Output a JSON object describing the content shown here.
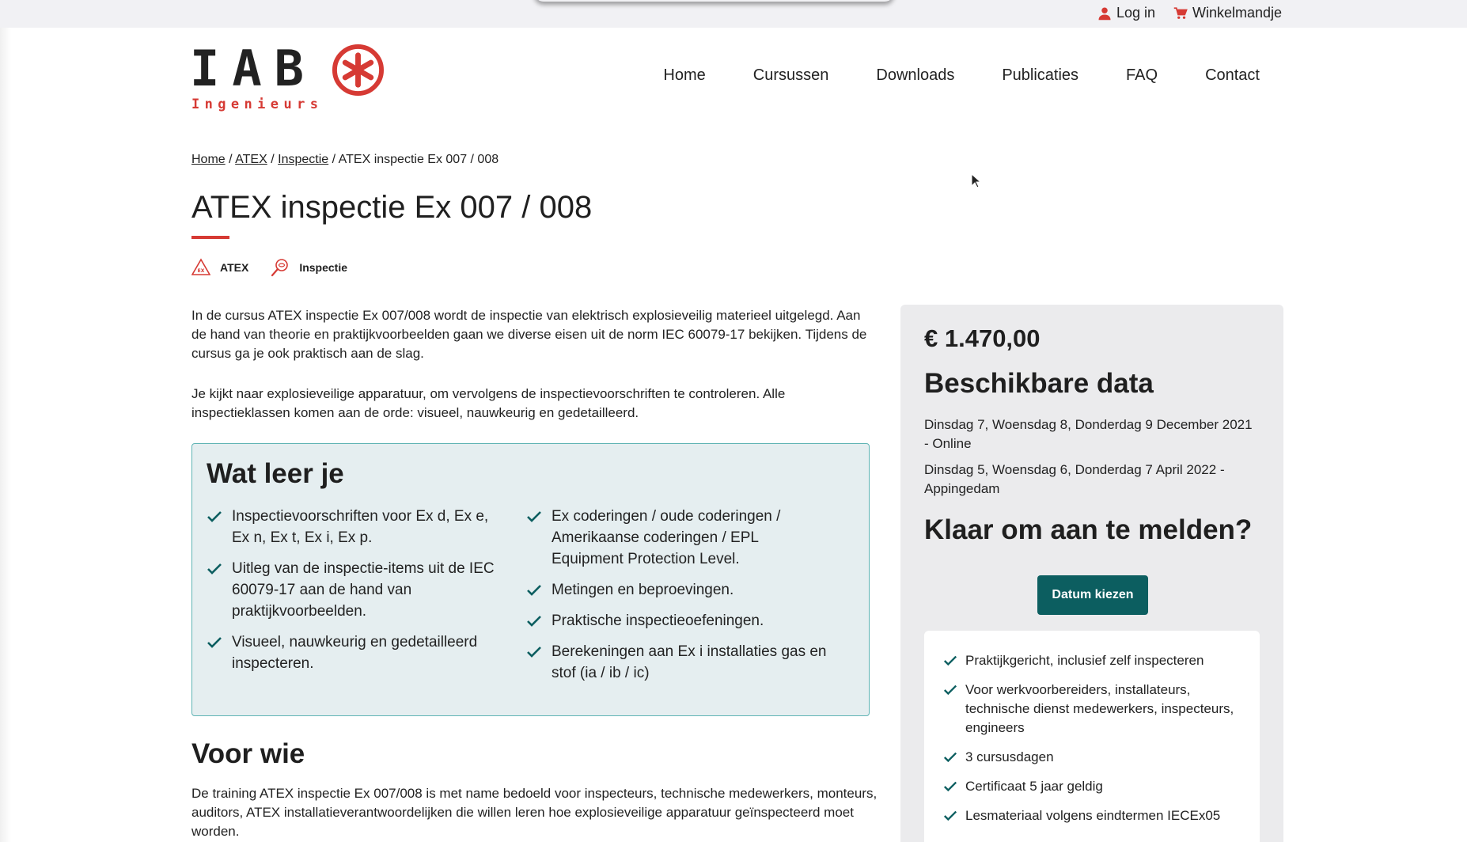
{
  "topbar": {
    "login": "Log in",
    "cart": "Winkelmandje"
  },
  "logo": {
    "letters": "IAB",
    "sub": "Ingenieurs"
  },
  "nav": [
    "Home",
    "Cursussen",
    "Downloads",
    "Publicaties",
    "FAQ",
    "Contact"
  ],
  "breadcrumb": {
    "home": "Home",
    "atex": "ATEX",
    "inspectie": "Inspectie",
    "current": "ATEX inspectie Ex 007 / 008",
    "sep": "/"
  },
  "page": {
    "title": "ATEX inspectie Ex 007 / 008",
    "tags": [
      "ATEX",
      "Inspectie"
    ],
    "intro1": "In de cursus ATEX inspectie Ex 007/008 wordt de inspectie van elektrisch explosieveilig materieel uitgelegd. Aan de hand van theorie en praktijkvoorbeelden gaan we diverse eisen uit de norm IEC 60079-17 bekijken. Tijdens de cursus ga je ook praktisch aan de slag.",
    "intro2": "Je kijkt naar explosieveilige apparatuur, om vervolgens de inspectievoorschriften te controleren. Alle inspectieklassen komen aan de orde: visueel, nauwkeurig en gedetailleerd."
  },
  "learn": {
    "title": "Wat leer je",
    "left": [
      "Inspectievoorschriften voor Ex d, Ex e, Ex n, Ex t, Ex i, Ex p.",
      "Uitleg van de inspectie-items uit de IEC 60079-17 aan de hand van praktijkvoorbeelden.",
      "Visueel, nauwkeurig en gedetailleerd inspecteren."
    ],
    "right": [
      "Ex coderingen / oude coderingen / Amerikaanse coderingen / EPL Equipment Protection Level.",
      "Metingen en beproevingen.",
      "Praktische inspectieoefeningen.",
      "Berekeningen aan Ex i installaties gas en stof (ia / ib / ic)"
    ]
  },
  "voorwie": {
    "title": "Voor wie",
    "text": "De training ATEX inspectie Ex 007/008 is met name bedoeld voor inspecteurs, technische medewerkers, monteurs, auditors, ATEX installatieverantwoordelijken die willen leren hoe explosieveilige apparatuur geïnspecteerd moet worden."
  },
  "sidebar": {
    "price": "€ 1.470,00",
    "dates_title": "Beschikbare data",
    "dates": [
      "Dinsdag 7, Woensdag 8, Donderdag 9 December 2021 - Online",
      "Dinsdag 5, Woensdag 6, Donderdag 7 April 2022 - Appingedam"
    ],
    "ready_title": "Klaar om aan te melden?",
    "cta": "Datum kiezen",
    "usps": [
      "Praktijkgericht, inclusief zelf inspecteren",
      "Voor werkvoorbereiders, installateurs, technische dienst medewerkers, inspecteurs, engineers",
      "3 cursusdagen",
      "Certificaat 5 jaar geldig",
      "Lesmateriaal volgens eindtermen IECEx05"
    ]
  },
  "colors": {
    "brand_red": "#d63a34",
    "teal": "#0c5e60",
    "learn_bg": "#e5eef0",
    "learn_border": "#5fb4b4"
  },
  "icons": [
    "user-icon",
    "cart-icon",
    "atex-icon",
    "inspectie-icon",
    "check-icon",
    "cursor-icon"
  ]
}
